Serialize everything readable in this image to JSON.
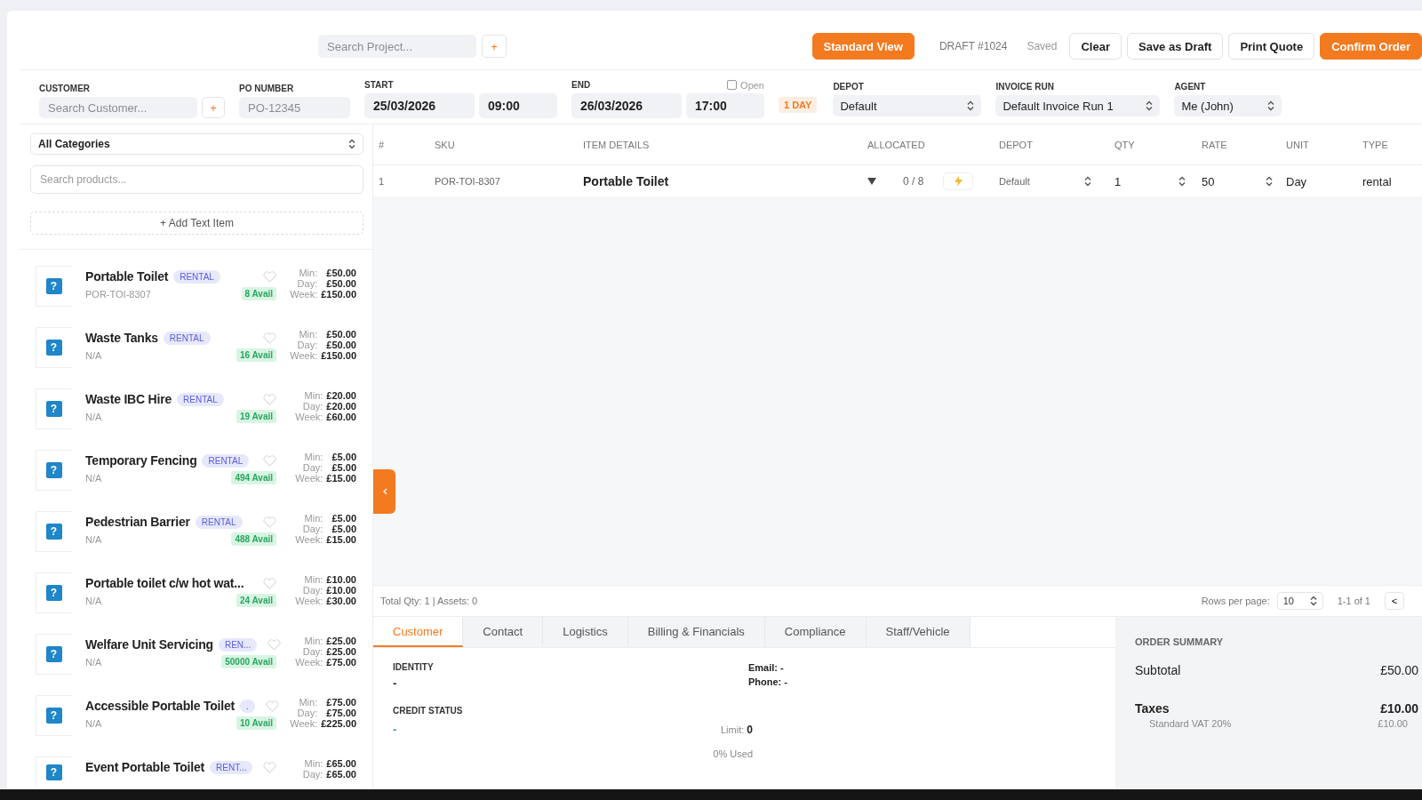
{
  "top_bar": {
    "project_search": {
      "placeholder": "Search Project..."
    },
    "add_project": "+",
    "view_button": "Standard View",
    "draft": "DRAFT #1024",
    "save_status": "Saved",
    "buttons": [
      {
        "label": "Clear",
        "kind": "plain"
      },
      {
        "label": "Save as Draft",
        "kind": "plain"
      },
      {
        "label": "Print Quote",
        "kind": "plain"
      },
      {
        "label": "Confirm Order",
        "kind": "primary"
      }
    ]
  },
  "order_form": {
    "customer": {
      "label": "CUSTOMER",
      "placeholder": "Search Customer...",
      "add": "+"
    },
    "po_number": {
      "label": "PO NUMBER",
      "placeholder": "PO-12345"
    },
    "start": {
      "label": "START",
      "date": "25/03/2026",
      "time": "09:00"
    },
    "end": {
      "label": "END",
      "date": "26/03/2026",
      "time": "17:00",
      "open_label": "Open",
      "open_checked": false
    },
    "duration": "1 DAY",
    "depot": {
      "label": "DEPOT",
      "value": "Default"
    },
    "invoice_run": {
      "label": "INVOICE RUN",
      "value": "Default Invoice Run 1"
    },
    "agent": {
      "label": "AGENT",
      "value": "Me (John)"
    }
  },
  "sidebar": {
    "category": "All Categories",
    "search": {
      "placeholder": "Search products..."
    },
    "add_text_item": "+ Add Text Item",
    "products": [
      {
        "thumb": "?",
        "name": "Portable Toilet",
        "tag": "RENTAL",
        "sku": "POR-TOI-8307",
        "avail": "8 Avail",
        "prices": [
          {
            "label": "Min:",
            "value": "£50.00"
          },
          {
            "label": "Day:",
            "value": "£50.00"
          },
          {
            "label": "Week:",
            "value": "£150.00"
          }
        ]
      },
      {
        "thumb": "?",
        "name": "Waste Tanks",
        "tag": "RENTAL",
        "sku": "N/A",
        "avail": "16 Avail",
        "prices": [
          {
            "label": "Min:",
            "value": "£50.00"
          },
          {
            "label": "Day:",
            "value": "£50.00"
          },
          {
            "label": "Week:",
            "value": "£150.00"
          }
        ]
      },
      {
        "thumb": "?",
        "name": "Waste IBC Hire",
        "tag": "RENTAL",
        "sku": "N/A",
        "avail": "19 Avail",
        "prices": [
          {
            "label": "Min:",
            "value": "£20.00"
          },
          {
            "label": "Day:",
            "value": "£20.00"
          },
          {
            "label": "Week:",
            "value": "£60.00"
          }
        ]
      },
      {
        "thumb": "?",
        "name": "Temporary Fencing",
        "tag": "RENTAL",
        "sku": "N/A",
        "avail": "494 Avail",
        "prices": [
          {
            "label": "Min:",
            "value": "£5.00"
          },
          {
            "label": "Day:",
            "value": "£5.00"
          },
          {
            "label": "Week:",
            "value": "£15.00"
          }
        ]
      },
      {
        "thumb": "?",
        "name": "Pedestrian Barrier",
        "tag": "RENTAL",
        "sku": "N/A",
        "avail": "488 Avail",
        "prices": [
          {
            "label": "Min:",
            "value": "£5.00"
          },
          {
            "label": "Day:",
            "value": "£5.00"
          },
          {
            "label": "Week:",
            "value": "£15.00"
          }
        ]
      },
      {
        "thumb": "?",
        "name": "Portable toilet c/w hot wat...",
        "sku": "N/A",
        "avail": "24 Avail",
        "prices": [
          {
            "label": "Min:",
            "value": "£10.00"
          },
          {
            "label": "Day:",
            "value": "£10.00"
          },
          {
            "label": "Week:",
            "value": "£30.00"
          }
        ]
      },
      {
        "thumb": "?",
        "name": "Welfare Unit Servicing",
        "tag": "REN...",
        "sku": "N/A",
        "avail": "50000 Avail",
        "prices": [
          {
            "label": "Min:",
            "value": "£25.00"
          },
          {
            "label": "Day:",
            "value": "£25.00"
          },
          {
            "label": "Week:",
            "value": "£75.00"
          }
        ]
      },
      {
        "thumb": "?",
        "name": "Accessible Portable Toilet",
        "tag": ".",
        "sku": "N/A",
        "avail": "10 Avail",
        "prices": [
          {
            "label": "Min:",
            "value": "£75.00"
          },
          {
            "label": "Day:",
            "value": "£75.00"
          },
          {
            "label": "Week:",
            "value": "£225.00"
          }
        ]
      },
      {
        "thumb": "?",
        "name": "Event Portable Toilet",
        "tag": "RENT...",
        "prices": [
          {
            "label": "Min:",
            "value": "£65.00"
          },
          {
            "label": "Day:",
            "value": "£65.00"
          }
        ]
      }
    ]
  },
  "table": {
    "columns": [
      "#",
      "SKU",
      "ITEM DETAILS",
      "ALLOCATED",
      "DEPOT",
      "QTY",
      "RATE",
      "UNIT",
      "TYPE"
    ],
    "rows": [
      {
        "index": "1",
        "sku": "POR-TOI-8307",
        "item": "Portable Toilet",
        "allocated": "0 / 8",
        "depot": "Default",
        "qty": "1",
        "rate": "50",
        "unit": "Day",
        "type": "rental"
      }
    ],
    "footer": {
      "totals": "Total Qty: 1 | Assets: 0",
      "rows_per_page_label": "Rows per page:",
      "rows_per_page": "10",
      "range": "1-1 of 1",
      "prev": "<"
    }
  },
  "tabs": [
    {
      "label": "Customer",
      "selected": true
    },
    {
      "label": "Contact",
      "selected": false
    },
    {
      "label": "Logistics",
      "selected": false
    },
    {
      "label": "Billing & Financials",
      "selected": false
    },
    {
      "label": "Compliance",
      "selected": false
    },
    {
      "label": "Staff/Vehicle",
      "selected": false
    }
  ],
  "customer_panel": {
    "identity_label": "IDENTITY",
    "identity": "-",
    "email": "Email: -",
    "phone": "Phone: -",
    "credit_label": "CREDIT STATUS",
    "credit": "-",
    "limit_label": "Limit:",
    "limit": "0",
    "used": "0% Used"
  },
  "order_summary": {
    "title": "ORDER SUMMARY",
    "subtotal_label": "Subtotal",
    "subtotal": "£50.00",
    "taxes_label": "Taxes",
    "taxes": "£10.00",
    "tax_lines": [
      {
        "label": "Standard VAT 20%",
        "value": "£10.00"
      }
    ]
  }
}
